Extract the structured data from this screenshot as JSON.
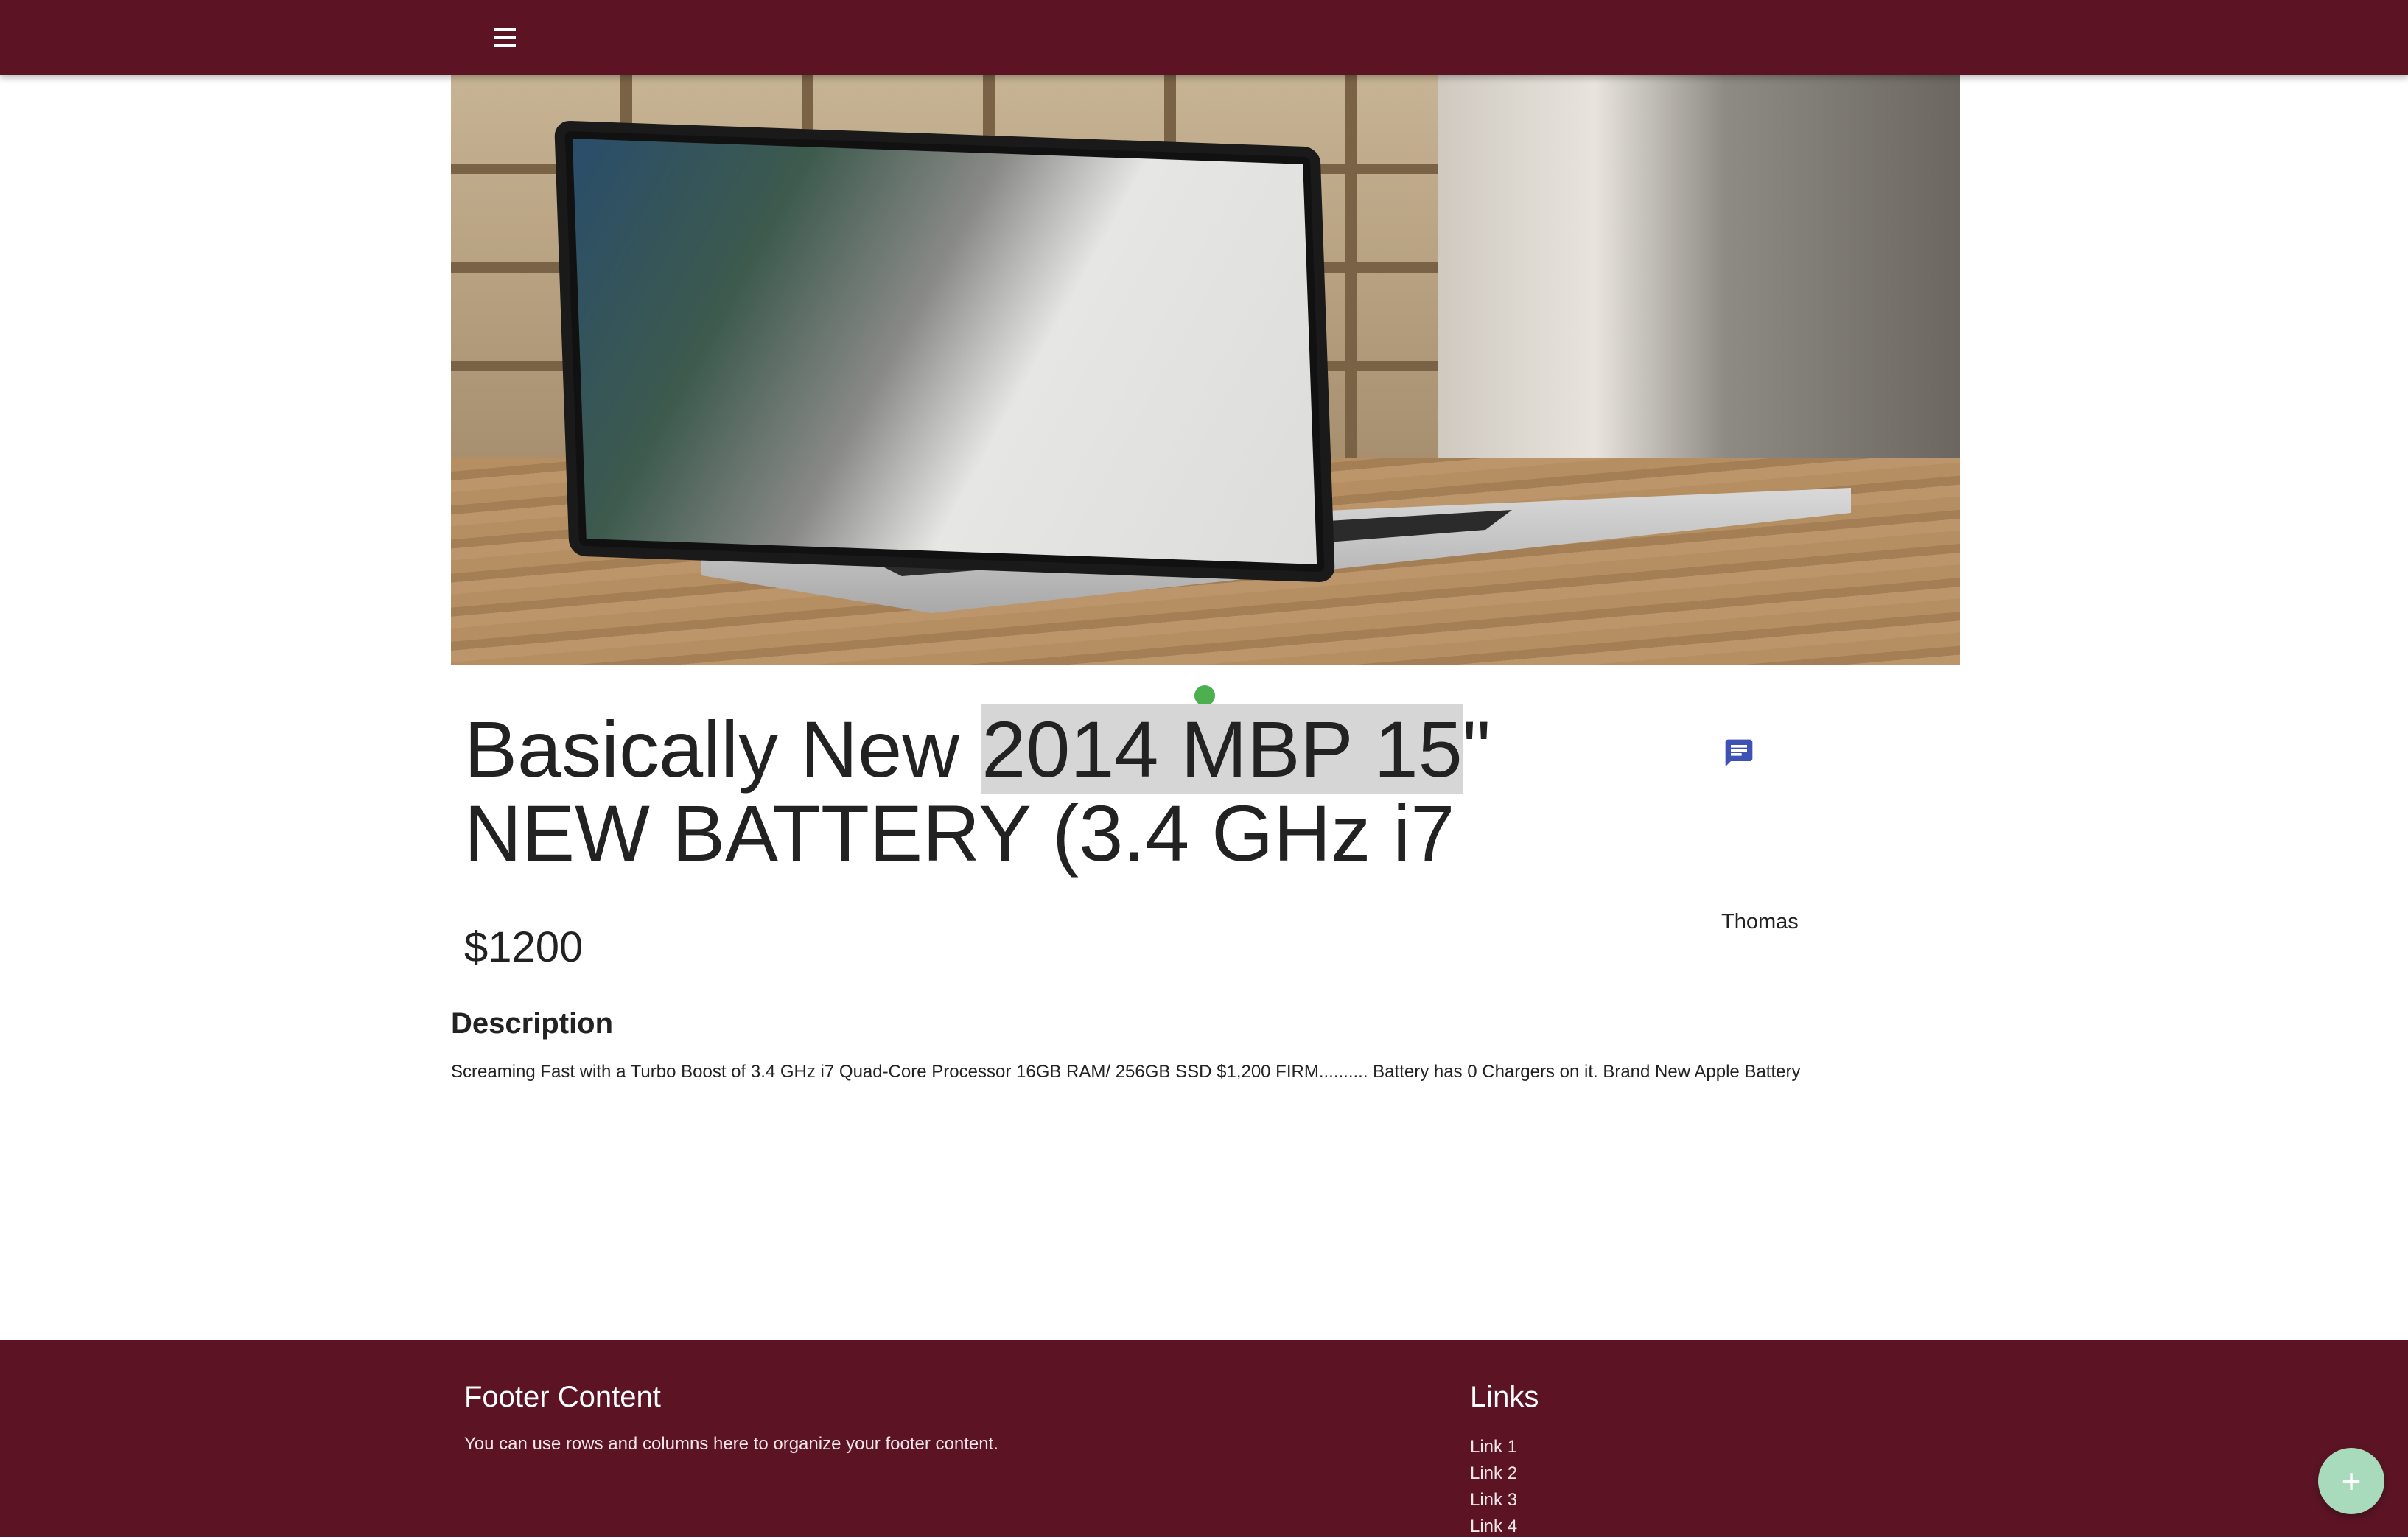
{
  "nav": {
    "menu_icon": "menu-icon"
  },
  "listing": {
    "title_before": "Basically New ",
    "title_highlight": "2014 MBP 15",
    "title_after": "\" NEW BATTERY (3.4 GHz i7",
    "price": "$1200",
    "seller": "Thomas",
    "chat_icon": "chat-icon",
    "description_heading": "Description",
    "description": "Screaming Fast with a Turbo Boost of 3.4 GHz i7 Quad-Core Processor 16GB RAM/ 256GB SSD $1,200 FIRM.......... Battery has 0 Chargers on it. Brand New Apple Battery"
  },
  "footer": {
    "title": "Footer Content",
    "text": "You can use rows and columns here to organize your footer content.",
    "links_title": "Links",
    "links": [
      "Link 1",
      "Link 2",
      "Link 3",
      "Link 4"
    ]
  },
  "fab": {
    "label": "+"
  },
  "colors": {
    "brand": "#5c1425",
    "status_dot": "#4caf50",
    "chat_icon": "#3f51b5",
    "fab": "#a8dbbc"
  }
}
